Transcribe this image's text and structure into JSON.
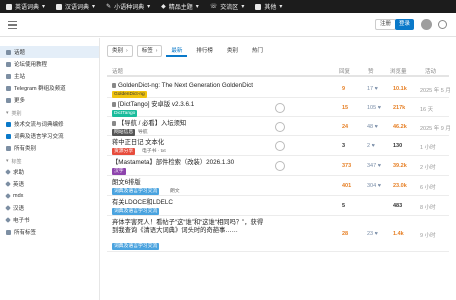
{
  "topbar": {
    "items": [
      "英语词典",
      "汉语词典",
      "小语种词典",
      "精品主题",
      "交流区",
      "其他"
    ]
  },
  "header": {
    "signup_label": "注册",
    "login_label": "登录"
  },
  "sidebar": {
    "items": [
      {
        "label": "话题",
        "active": true
      },
      {
        "label": "论坛使用教程"
      },
      {
        "label": "主站"
      },
      {
        "label": "Telegram 群组及频道"
      },
      {
        "label": "更多"
      }
    ],
    "categories_header": "类别",
    "categories": [
      {
        "label": "技术交流与词典编修"
      },
      {
        "label": "词典及语言学习交流"
      },
      {
        "label": "所有类别"
      }
    ],
    "tags_header": "标签",
    "tags": [
      {
        "label": "求助"
      },
      {
        "label": "英语"
      },
      {
        "label": "mdx"
      },
      {
        "label": "汉语"
      },
      {
        "label": "电子书"
      },
      {
        "label": "所有标签"
      }
    ]
  },
  "nav": {
    "category_dropdown": "类别",
    "tags_dropdown": "标签",
    "tabs": [
      "最新",
      "排行榜",
      "类别",
      "热门"
    ],
    "active_tab": "最新"
  },
  "table": {
    "headers": {
      "topic": "话题",
      "replies": "回复",
      "likes": "赞",
      "views": "浏览量",
      "activity": "活动"
    },
    "rows": [
      {
        "title": "GoldenDict-ng: The Next Generation GoldenDict",
        "pinned": true,
        "category": "GoldenDict-ng",
        "cat_color": "#f1c40f",
        "cat_text": "#333",
        "tags": "",
        "avatar": false,
        "replies": "9",
        "reply_color": "#e67e22",
        "likes": "17",
        "views": "10.1k",
        "views_color": "#e67e22",
        "activity": "2025 年 5 月"
      },
      {
        "title": "[DictTango] 安卓版 v2.3.6.1",
        "pinned": true,
        "category": "DictTango",
        "cat_color": "#1abc9c",
        "cat_text": "#fff",
        "tags": "",
        "avatar": true,
        "replies": "15",
        "reply_color": "#e67e22",
        "likes": "105",
        "views": "217k",
        "views_color": "#e67e22",
        "activity": "16 天"
      },
      {
        "title": "【导航 / 必看】入坛须知",
        "pinned": true,
        "category": "网站信息",
        "cat_color": "#555555",
        "cat_text": "#fff",
        "tags": "导航",
        "avatar": true,
        "replies": "24",
        "reply_color": "#e67e22",
        "likes": "48",
        "views": "46.2k",
        "views_color": "#e67e22",
        "activity": "2025 年 9 月"
      },
      {
        "title": "蒋中正日记 文本化",
        "pinned": false,
        "category": "资源分享",
        "cat_color": "#e74c3c",
        "cat_text": "#fff",
        "tags": "电子书 · txt",
        "avatar": true,
        "replies": "3",
        "reply_color": "#333",
        "likes": "2",
        "views": "130",
        "views_color": "#333",
        "activity": "1 小时"
      },
      {
        "title": "【Mastameta】部件检索（改装）2026.1.30",
        "pinned": false,
        "category": "汉字",
        "cat_color": "#8e44ad",
        "cat_text": "#fff",
        "tags": "",
        "avatar": true,
        "replies": "373",
        "reply_color": "#e67e22",
        "likes": "347",
        "views": "39.2k",
        "views_color": "#e67e22",
        "activity": "2 小时"
      },
      {
        "title": "朗文6排版",
        "pinned": false,
        "category": "词典及语言学习交流",
        "cat_color": "#4aa3df",
        "cat_text": "#fff",
        "tags": "朗文",
        "avatar": false,
        "replies": "401",
        "reply_color": "#e67e22",
        "likes": "304",
        "views": "23.0k",
        "views_color": "#e67e22",
        "activity": "6 小时"
      },
      {
        "title": "有关LDOCE和LDELC",
        "pinned": false,
        "category": "词典及语言学习交流",
        "cat_color": "#4aa3df",
        "cat_text": "#fff",
        "tags": "",
        "avatar": false,
        "replies": "5",
        "reply_color": "#333",
        "likes": "",
        "views": "483",
        "views_color": "#333",
        "activity": "8 小时"
      },
      {
        "title": "弃体字害死人！看帖子“这“谁”和“这谁“相同吗？”，获得到我查询《清语大词典》词头时的奇葩事……",
        "pinned": false,
        "category": "词典及语言学习交流",
        "cat_color": "#4aa3df",
        "cat_text": "#fff",
        "tags": "",
        "avatar": false,
        "replies": "28",
        "reply_color": "#e67e22",
        "likes": "23",
        "views": "1.4k",
        "views_color": "#e67e22",
        "activity": "9 小时"
      }
    ]
  }
}
